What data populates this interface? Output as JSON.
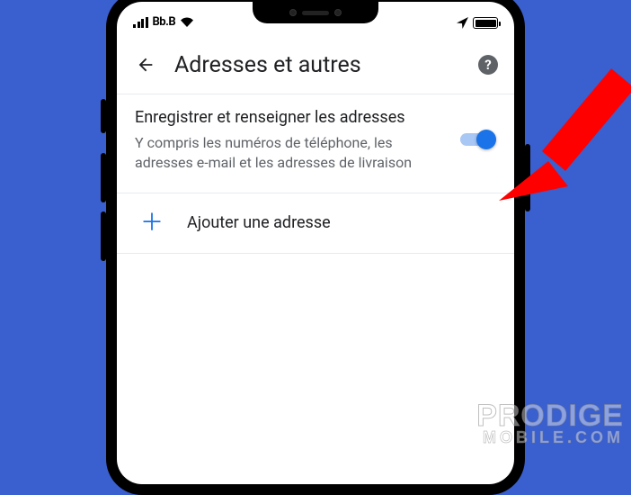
{
  "statusbar": {
    "carrier": "Bb.B"
  },
  "header": {
    "title": "Adresses et autres"
  },
  "setting": {
    "title": "Enregistrer et renseigner les adresses",
    "description": "Y compris les numéros de téléphone, les adresses e-mail et les adresses de livraison",
    "enabled": true
  },
  "add": {
    "label": "Ajouter une adresse"
  },
  "watermark": {
    "line1": "PRODIGE",
    "line2": "MOBILE.COM"
  }
}
